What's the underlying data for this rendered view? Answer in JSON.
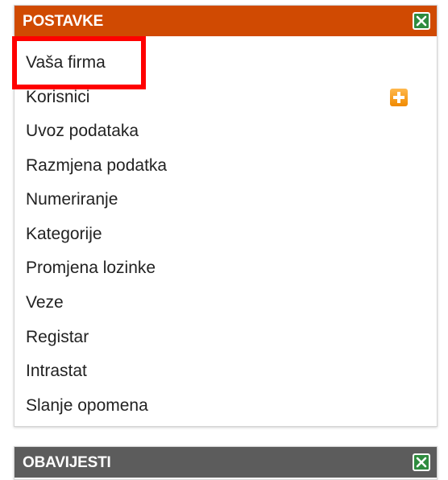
{
  "settings_panel": {
    "title": "POSTAVKE",
    "items": [
      {
        "label": "Vaša firma"
      },
      {
        "label": "Korisnici"
      },
      {
        "label": "Uvoz podataka"
      },
      {
        "label": "Razmjena podatka"
      },
      {
        "label": "Numeriranje"
      },
      {
        "label": "Kategorije"
      },
      {
        "label": "Promjena lozinke"
      },
      {
        "label": "Veze"
      },
      {
        "label": "Registar"
      },
      {
        "label": "Intrastat"
      },
      {
        "label": "Slanje opomena"
      }
    ]
  },
  "news_panel": {
    "title": "OBAVIJESTI"
  },
  "colors": {
    "settings_header": "#d04a02",
    "news_header": "#5c5c5c",
    "close_button": "#2e8b3e",
    "add_icon": "#f08a00",
    "highlight": "#ff0000"
  },
  "icons": {
    "close": "close-icon",
    "add": "plus-icon"
  }
}
